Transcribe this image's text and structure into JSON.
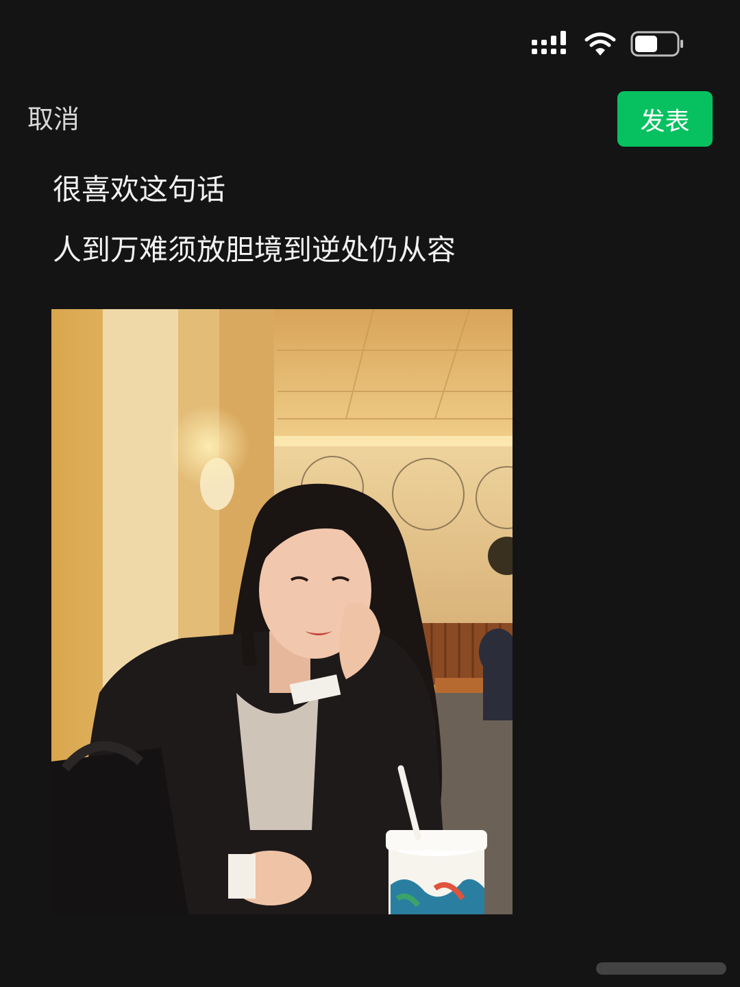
{
  "header": {
    "cancel_label": "取消",
    "publish_label": "发表"
  },
  "post": {
    "lines": [
      "很喜欢这句话",
      "人到万难须放胆境到逆处仍从容"
    ]
  },
  "status_bar": {
    "signal_icon": "signal-icon",
    "wifi_icon": "wifi-icon",
    "battery_icon": "battery-icon",
    "battery_level": 0.55
  },
  "colors": {
    "background": "#141414",
    "accent": "#07c160",
    "cancel_text": "#d8d8d8"
  }
}
